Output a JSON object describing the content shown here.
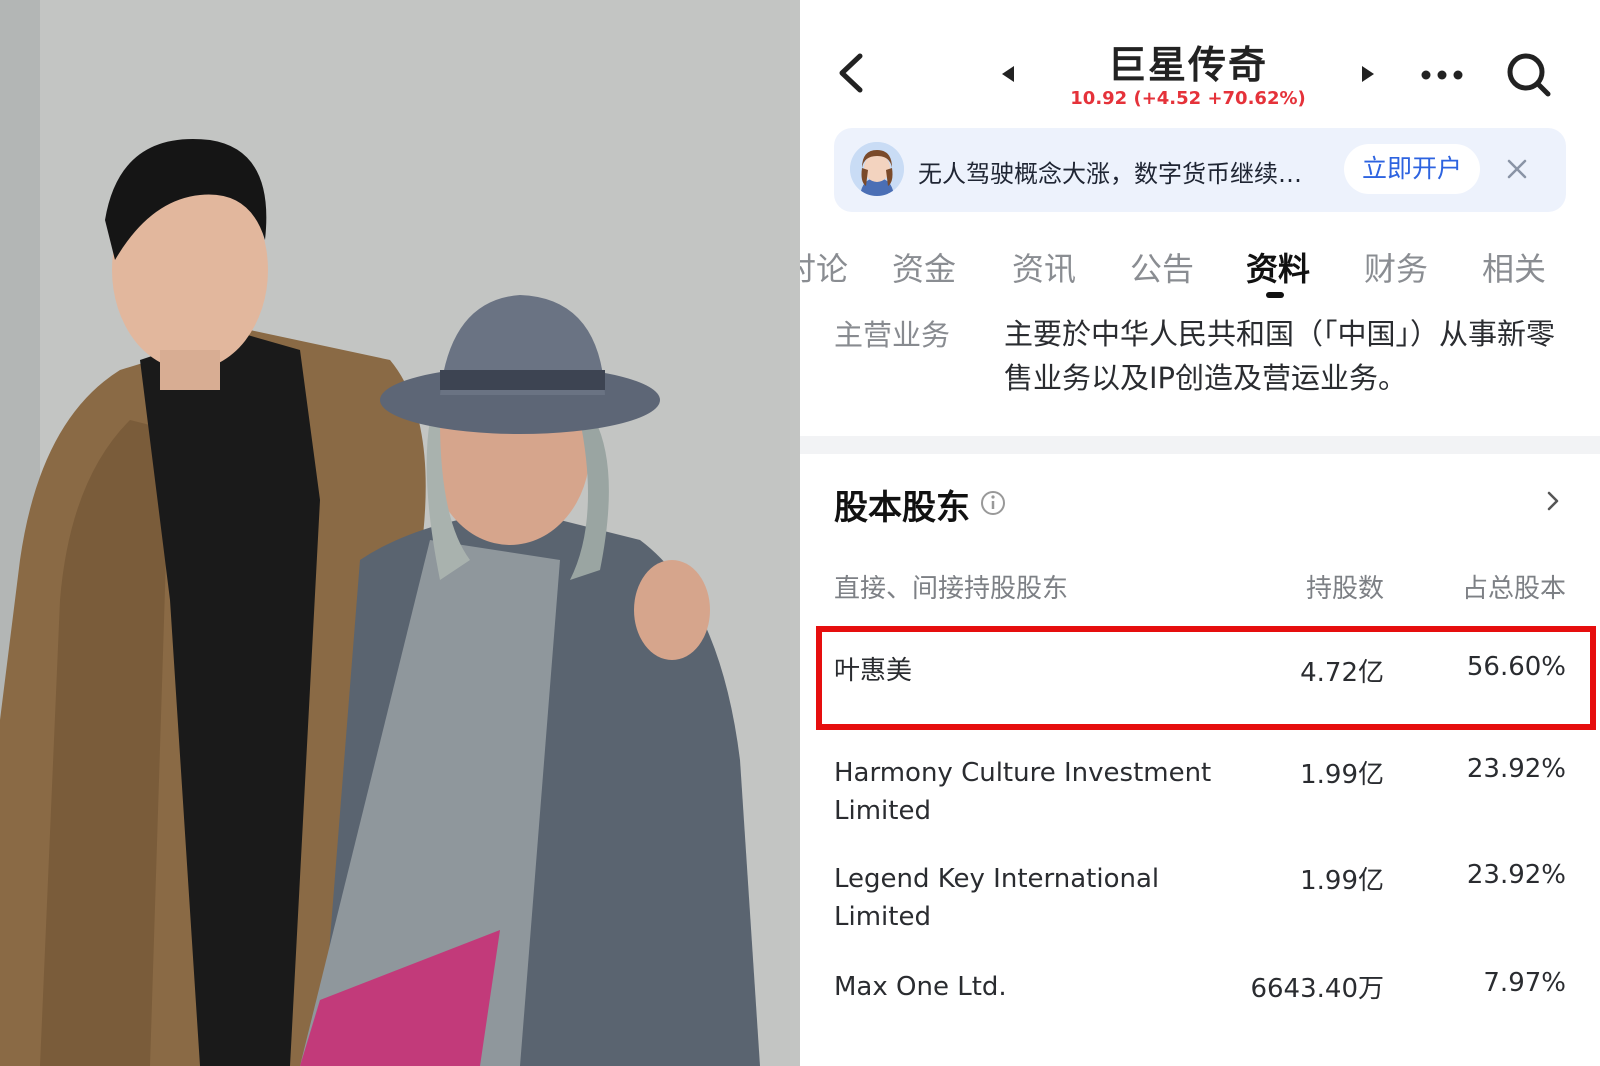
{
  "header": {
    "title": "巨星传奇",
    "price_line": "10.92 (+4.52 +70.62%)"
  },
  "promo": {
    "text": "无人驾驶概念大涨，数字货币继续…",
    "button_label": "立即开户"
  },
  "tabs": [
    {
      "label": "讨论"
    },
    {
      "label": "资金"
    },
    {
      "label": "资讯"
    },
    {
      "label": "公告"
    },
    {
      "label": "资料"
    },
    {
      "label": "财务"
    },
    {
      "label": "相关"
    }
  ],
  "active_tab": "资料",
  "business": {
    "label": "主营业务",
    "text": "主要於中华人民共和国（「中国」）从事新零售业务以及IP创造及营运业务。"
  },
  "shareholders": {
    "title": "股本股东",
    "columns": [
      "直接、间接持股股东",
      "持股数",
      "占总股本"
    ],
    "rows": [
      {
        "name": "叶惠美",
        "shares": "4.72亿",
        "pct": "56.60%"
      },
      {
        "name": "Harmony Culture Investment Limited",
        "shares": "1.99亿",
        "pct": "23.92%"
      },
      {
        "name": "Legend Key International Limited",
        "shares": "1.99亿",
        "pct": "23.92%"
      },
      {
        "name": "Max One Ltd.",
        "shares": "6643.40万",
        "pct": "7.97%"
      }
    ]
  },
  "colors": {
    "price_up": "#e5323a",
    "accent_blue": "#2d63e0",
    "highlight_red": "#e60e0e",
    "promo_bg": "#edf2fc"
  }
}
